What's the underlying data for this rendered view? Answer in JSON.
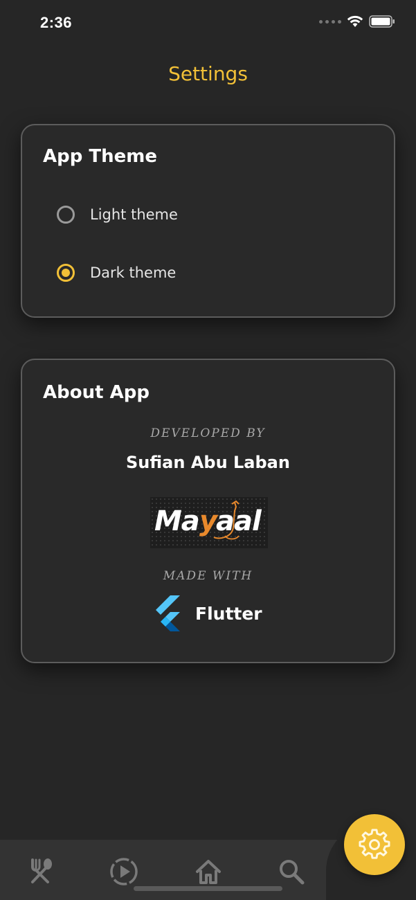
{
  "status_bar": {
    "time": "2:36"
  },
  "header": {
    "title": "Settings"
  },
  "theme_section": {
    "title": "App Theme",
    "options": [
      {
        "label": "Light theme",
        "selected": false
      },
      {
        "label": "Dark theme",
        "selected": true
      }
    ]
  },
  "about_section": {
    "title": "About App",
    "developed_by_caption": "DEVELOPED BY",
    "developer_name": "Sufian Abu Laban",
    "logo_text": "Mayaal",
    "made_with_caption": "MADE WITH",
    "framework_name": "Flutter"
  },
  "bottom_nav": {
    "items": [
      {
        "icon": "restaurant-icon"
      },
      {
        "icon": "play-circle-icon"
      },
      {
        "icon": "home-icon"
      },
      {
        "icon": "search-icon"
      }
    ],
    "fab_icon": "settings-gear-icon"
  },
  "colors": {
    "accent": "#f2c037",
    "background": "#262626",
    "card_border": "#5c5c5c",
    "nav_bar": "#333333",
    "flutter_blue": "#42a5f5",
    "logo_orange": "#e8892c"
  }
}
